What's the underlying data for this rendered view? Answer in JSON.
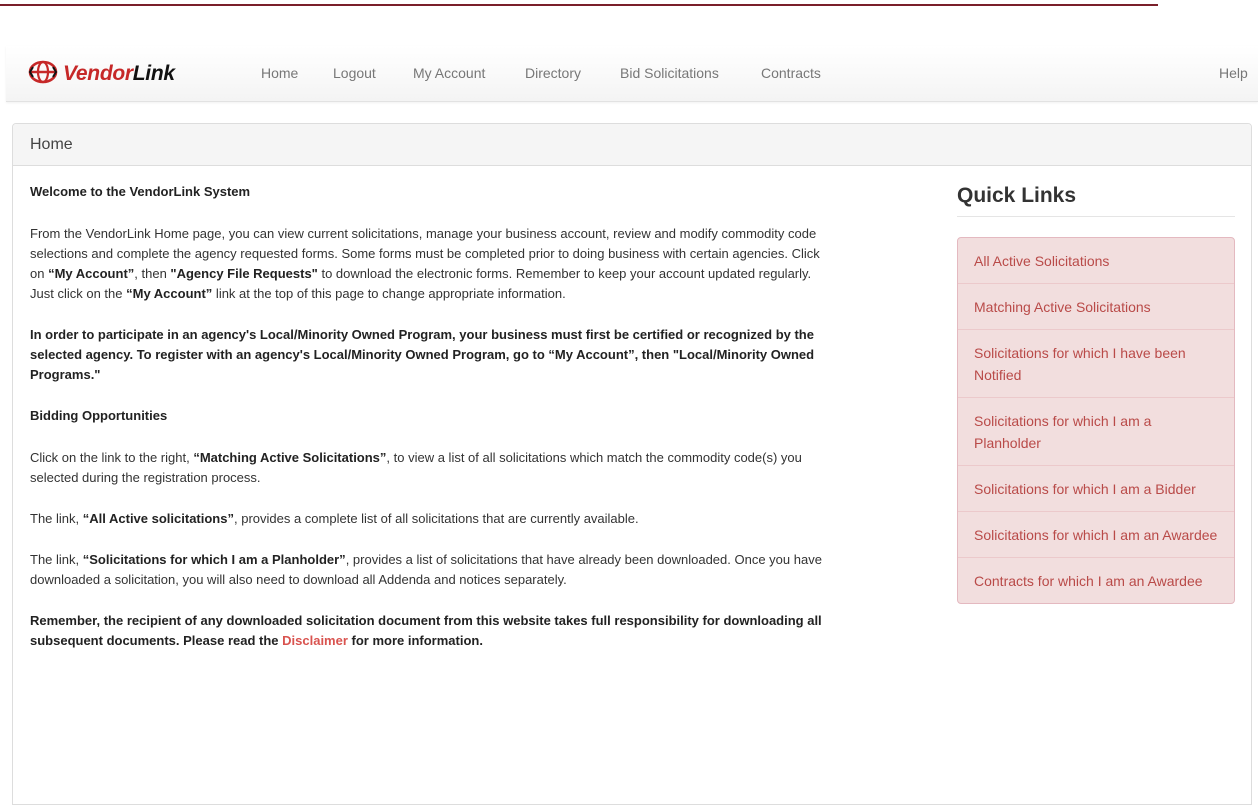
{
  "brand": {
    "prefix": "Vendor",
    "suffix": "Link"
  },
  "nav": {
    "items": [
      {
        "label": "Home"
      },
      {
        "label": "Logout"
      },
      {
        "label": "My Account"
      },
      {
        "label": "Directory"
      },
      {
        "label": "Bid Solicitations"
      },
      {
        "label": "Contracts"
      }
    ],
    "help": "Help"
  },
  "panel": {
    "heading": "Home"
  },
  "content": {
    "welcome": "Welcome to the VendorLink System",
    "intro": {
      "t1": "From the VendorLink Home page, you can view current solicitations, manage your business account, review and modify commodity code selections and complete the agency requested forms. Some forms must be completed prior to doing business with certain agencies. Click on ",
      "b1": "“My Account”",
      "t2": ", then ",
      "b2": "\"Agency File Requests\"",
      "t3": " to download the electronic forms. Remember to keep your account updated regularly. Just click on the ",
      "b3": "“My Account”",
      "t4": " link at the top of this page to change appropriate information."
    },
    "program": "In order to participate in an agency's Local/Minority Owned Program, your business must first be certified or recognized by the selected agency. To register with an agency's Local/Minority Owned Program, go to “My Account”, then \"Local/Minority Owned Programs.\"",
    "bidding_heading": "Bidding Opportunities",
    "matching": {
      "t1": "Click on the link to the right, ",
      "b1": "“Matching Active Solicitations”",
      "t2": ", to view a list of all solicitations which match the commodity code(s) you selected during the registration process."
    },
    "all_active": {
      "t1": "The link, ",
      "b1": "“All Active solicitations”",
      "t2": ", provides a complete list of all solicitations that are currently available."
    },
    "planholder": {
      "t1": "The link, ",
      "b1": "“Solicitations for which I am a Planholder”",
      "t2": ", provides a list of solicitations that have already been downloaded. Once you have downloaded a solicitation, you will also need to download all Addenda and notices separately."
    },
    "disclaimer": {
      "t1": "Remember, the recipient of any downloaded solicitation document from this website takes full responsibility for downloading all subsequent documents. Please read the ",
      "link": "Disclaimer",
      "t2": " for more information."
    }
  },
  "quick_links": {
    "title": "Quick Links",
    "items": [
      {
        "label": "All Active Solicitations"
      },
      {
        "label": "Matching Active Solicitations"
      },
      {
        "label": "Solicitations for which I have been Notified"
      },
      {
        "label": "Solicitations for which I am a Planholder"
      },
      {
        "label": "Solicitations for which I am a Bidder"
      },
      {
        "label": "Solicitations for which I am an Awardee"
      },
      {
        "label": "Contracts for which I am an Awardee"
      }
    ]
  },
  "colors": {
    "accent": "#7a1f2a",
    "brand_red": "#c62828",
    "link": "#b94a48",
    "quick_links_bg": "#f2dede"
  }
}
